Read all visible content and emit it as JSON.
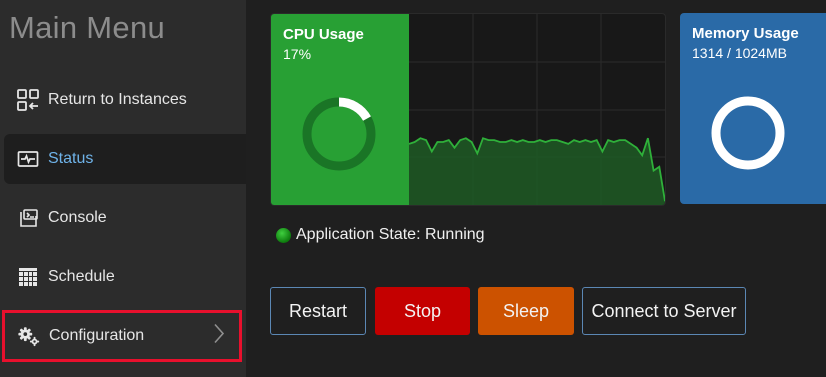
{
  "sidebar": {
    "title": "Main Menu",
    "items": [
      {
        "label": "Return to Instances",
        "icon": "grid-return-icon"
      },
      {
        "label": "Status",
        "icon": "monitor-pulse-icon"
      },
      {
        "label": "Console",
        "icon": "terminal-icon"
      },
      {
        "label": "Schedule",
        "icon": "calendar-grid-icon"
      },
      {
        "label": "Configuration",
        "icon": "gears-icon"
      }
    ],
    "active_item": "Status"
  },
  "cpu": {
    "title": "CPU Usage",
    "value": "17%",
    "usage_fraction": 0.17,
    "history_percent": [
      32,
      33,
      35,
      34,
      28,
      33,
      33,
      34,
      30,
      34,
      35,
      33,
      27,
      35,
      34,
      34,
      33,
      33,
      34,
      33,
      34,
      33,
      33,
      34,
      33,
      34,
      34,
      33,
      32,
      34,
      33,
      34,
      33,
      34,
      28,
      34,
      33,
      34,
      34,
      32,
      30,
      26,
      35,
      18,
      20,
      2
    ]
  },
  "memory": {
    "title": "Memory Usage",
    "value": "1314 / 1024MB"
  },
  "app_state": {
    "label": "Application State: Running"
  },
  "buttons": {
    "restart": "Restart",
    "stop": "Stop",
    "sleep": "Sleep",
    "connect": "Connect to Server"
  },
  "colors": {
    "sidebar_bg": "#2c2c2c",
    "main_bg": "#1f1f1f",
    "cpu_green": "#28a034",
    "memory_blue": "#2a6aa7",
    "active_text": "#6fb3e9",
    "highlight_border": "#e8102d",
    "stop_red": "#c40000",
    "sleep_orange": "#cc5200"
  }
}
